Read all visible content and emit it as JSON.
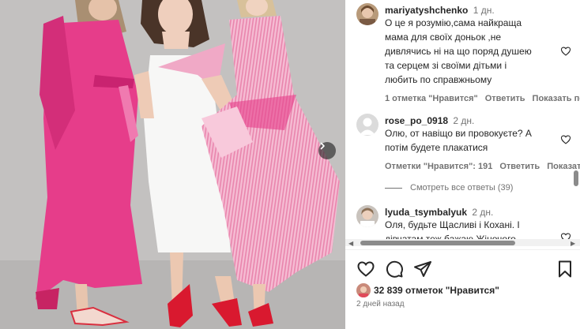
{
  "photo": {
    "alt": "",
    "colors": {
      "background": "#c3c1c0",
      "dress_pink": "#e63d8a",
      "dress_white": "#f7f7f6",
      "dress_stripe": "#f0a9c6"
    }
  },
  "comments": [
    {
      "username": "mariyatyshchenko",
      "date": "1 дн.",
      "lines": [
        "О це я розумію,сама найкраща",
        "мама для своїх доньок ,не",
        "дивлячись ні на що поряд душею",
        "та серцем зі своїми дітьми і",
        "любить по справжньому"
      ],
      "likes": "1 отметка \"Нравится\"",
      "reply": "Ответить",
      "translate": "Показать перевод"
    },
    {
      "username": "rose_po_0918",
      "date": "2 дн.",
      "lines": [
        "Олю, от навіщо ви провокуєте? А",
        "потім будете плакатися"
      ],
      "likes": "Отметки \"Нравится\": 191",
      "reply": "Ответить",
      "translate": "Показать перевод",
      "view_replies": "Смотреть все ответы (39)"
    },
    {
      "username": "lyuda_tsymbalyuk",
      "date": "2 дн.",
      "lines": [
        "Оля, будьте Щасливі і Кохані. І",
        "дівчатам теж бажаю Жіночого"
      ]
    }
  ],
  "actions": {
    "like_icon": "heart-icon",
    "comment_icon": "comment-icon",
    "share_icon": "share-icon",
    "save_icon": "bookmark-icon"
  },
  "likes": {
    "count_text": "32 839 отметок \"Нравится\""
  },
  "post_date": "2 дней назад"
}
